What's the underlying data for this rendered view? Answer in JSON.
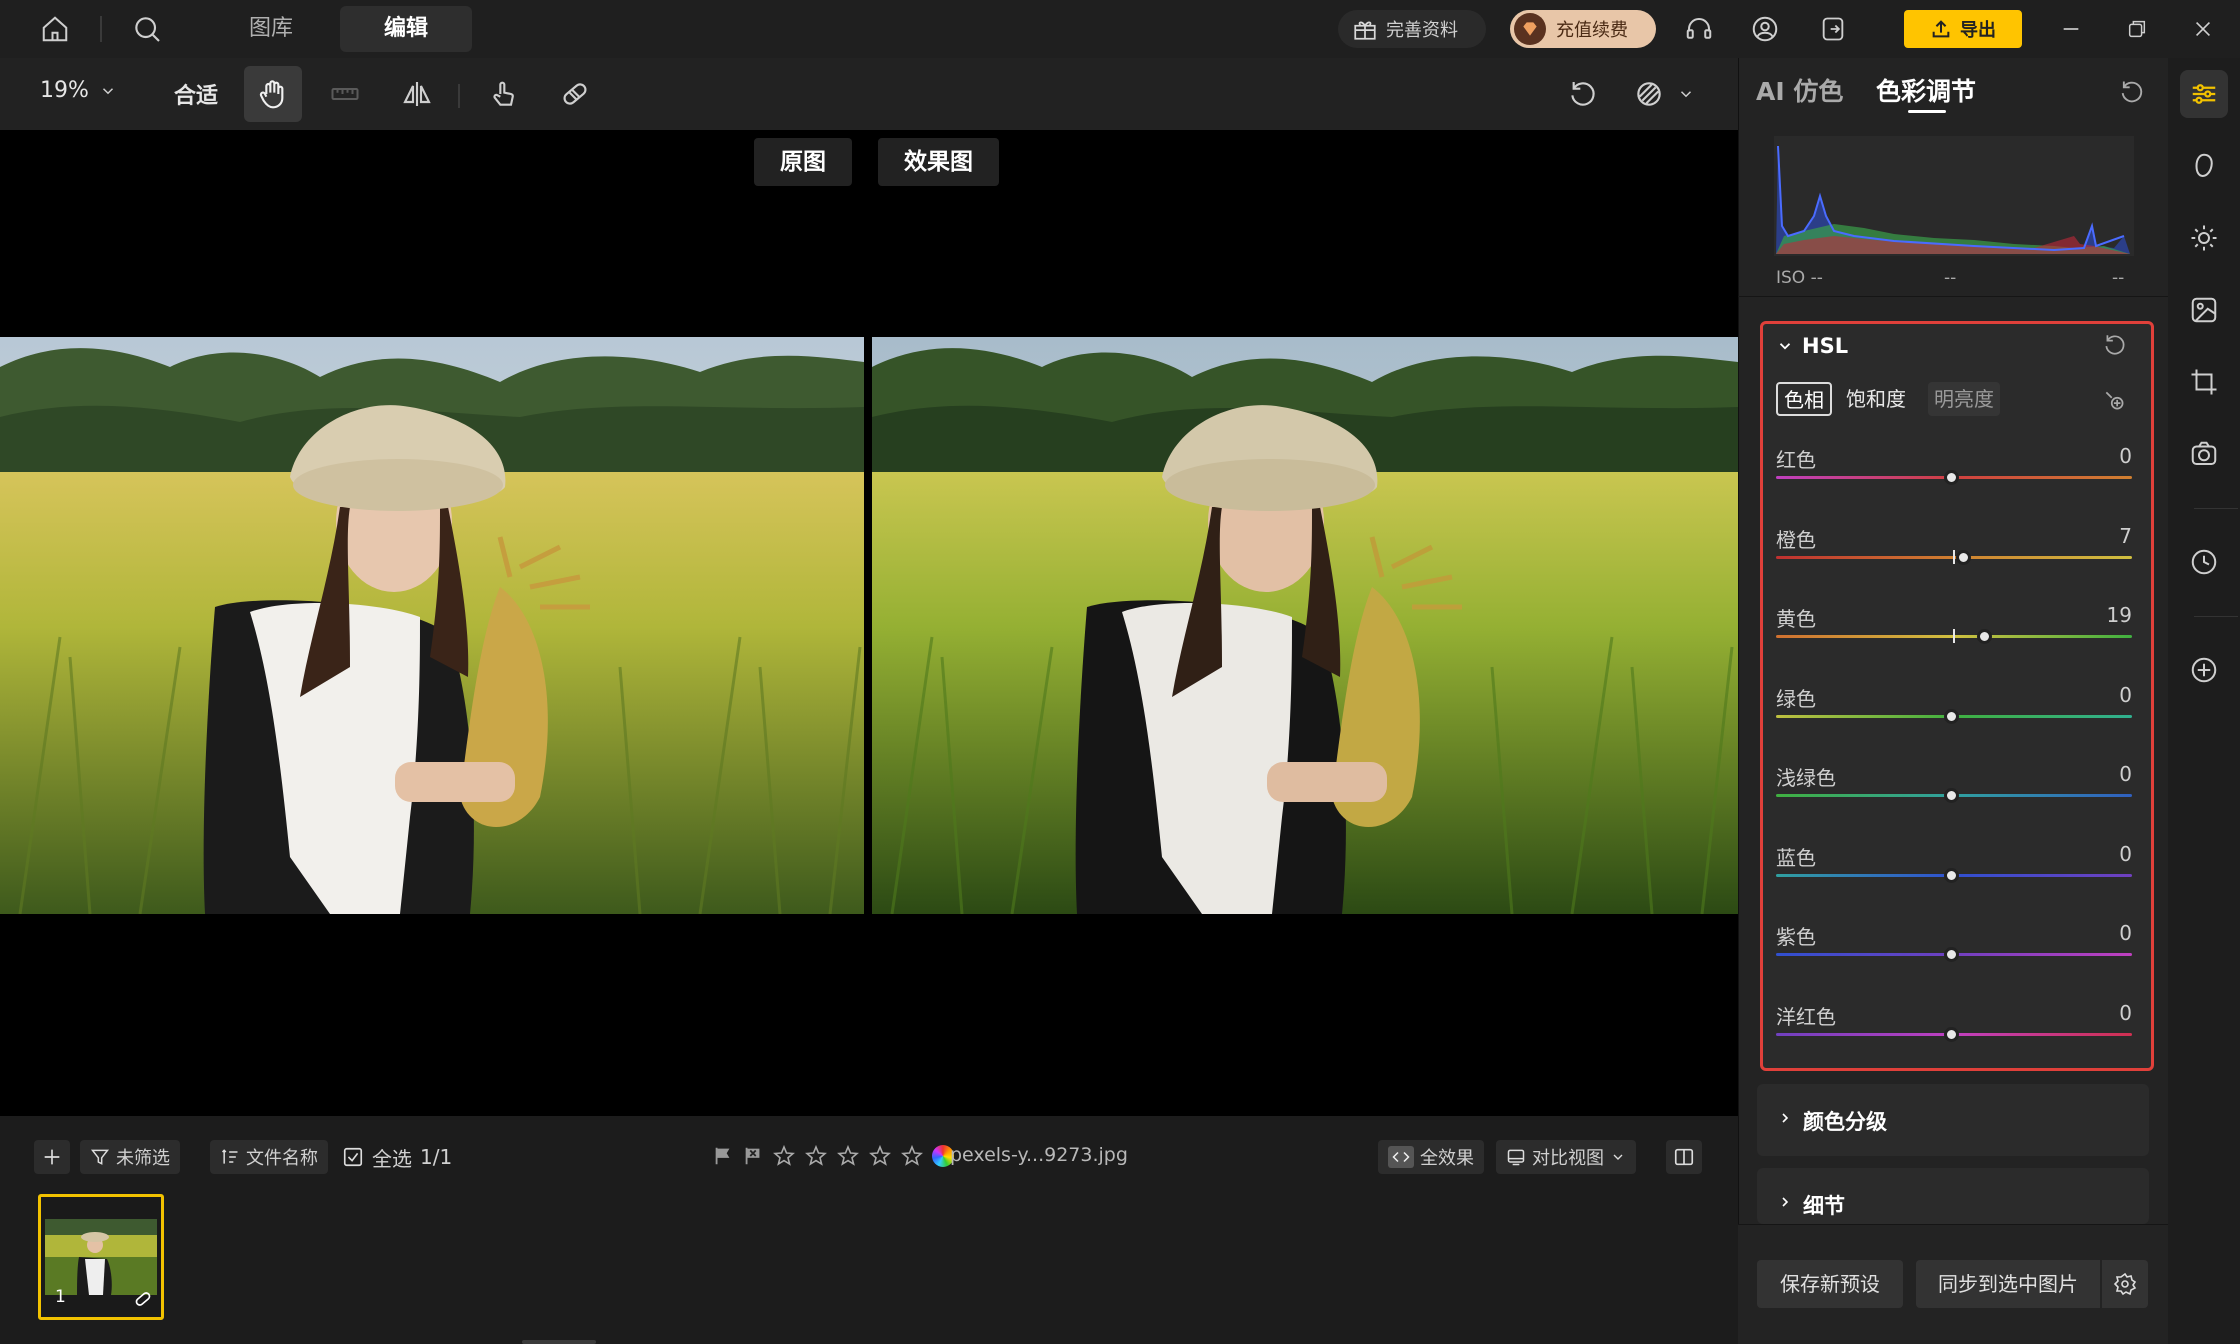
{
  "topbar": {
    "tabs": [
      {
        "label": "图库",
        "active": false
      },
      {
        "label": "编辑",
        "active": true
      }
    ],
    "complete_profile_label": "完善资料",
    "recharge_label": "充值续费",
    "export_label": "导出",
    "export_color": "#ffc400"
  },
  "toolbar": {
    "zoom_value": "19%",
    "fit_label": "合适"
  },
  "canvas": {
    "original_label": "原图",
    "effect_label": "效果图"
  },
  "panel": {
    "tabs": [
      {
        "label": "AI 仿色",
        "active": false
      },
      {
        "label": "色彩调节",
        "active": true
      }
    ],
    "histogram": {
      "iso_label": "ISO --",
      "mid_label": "--",
      "right_label": "--"
    },
    "hsl": {
      "title": "HSL",
      "modes": [
        {
          "label": "色相",
          "active": true
        },
        {
          "label": "饱和度",
          "active": false
        },
        {
          "label": "明亮度",
          "active": false
        }
      ],
      "sliders": [
        {
          "label": "红色",
          "value": "0",
          "num": 0
        },
        {
          "label": "橙色",
          "value": "7",
          "num": 7
        },
        {
          "label": "黄色",
          "value": "19",
          "num": 19
        },
        {
          "label": "绿色",
          "value": "0",
          "num": 0
        },
        {
          "label": "浅绿色",
          "value": "0",
          "num": 0
        },
        {
          "label": "蓝色",
          "value": "0",
          "num": 0
        },
        {
          "label": "紫色",
          "value": "0",
          "num": 0
        },
        {
          "label": "洋红色",
          "value": "0",
          "num": 0
        }
      ],
      "range": [
        -100,
        100
      ],
      "highlight_color": "#e0403a"
    },
    "color_grading_label": "颜色分级",
    "detail_label": "细节",
    "save_preset_label": "保存新预设",
    "sync_label": "同步到选中图片"
  },
  "filmbar": {
    "unfiltered_label": "未筛选",
    "filename_label": "文件名称",
    "select_all_label": "全选",
    "count_label": "1/1",
    "file_name": "pexels-y...9273.jpg",
    "full_effect_label": "全效果",
    "compare_view_label": "对比视图"
  },
  "filmstrip": {
    "thumb_index": "1",
    "selected_color": "#f2c200"
  }
}
